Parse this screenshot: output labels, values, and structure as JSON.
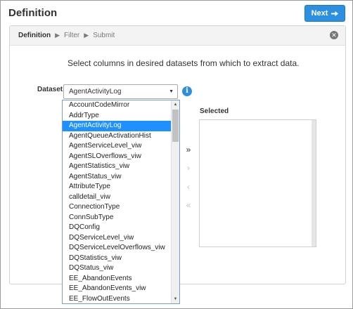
{
  "header": {
    "title": "Definition",
    "next_label": "Next"
  },
  "breadcrumb": {
    "steps": [
      "Definition",
      "Filter",
      "Submit"
    ]
  },
  "instructions": "Select columns in desired datasets from which to extract data.",
  "dataset": {
    "label": "Dataset",
    "selected_value": "AgentActivityLog",
    "options": [
      "AccountCodeMirror",
      "AddrType",
      "AgentActivityLog",
      "AgentQueueActivationHist",
      "AgentServiceLevel_viw",
      "AgentSLOverflows_viw",
      "AgentStatistics_viw",
      "AgentStatus_viw",
      "AttributeType",
      "calldetail_viw",
      "ConnectionType",
      "ConnSubType",
      "DQConfig",
      "DQServiceLevel_viw",
      "DQServiceLevelOverflows_viw",
      "DQStatistics_viw",
      "DQStatus_viw",
      "EE_AbandonEvents",
      "EE_AbandonEvents_viw",
      "EE_FlowOutEvents"
    ],
    "highlighted_index": 2
  },
  "selected_panel": {
    "label": "Selected"
  },
  "move_buttons": {
    "add_all": "»",
    "add": "›",
    "remove": "‹",
    "remove_all": "«"
  },
  "colors": {
    "accent": "#2d8fe0",
    "highlight": "#1e90ff"
  },
  "icons": {
    "next": "arrow-right-icon",
    "close": "close-circle-icon",
    "info": "info-icon"
  }
}
